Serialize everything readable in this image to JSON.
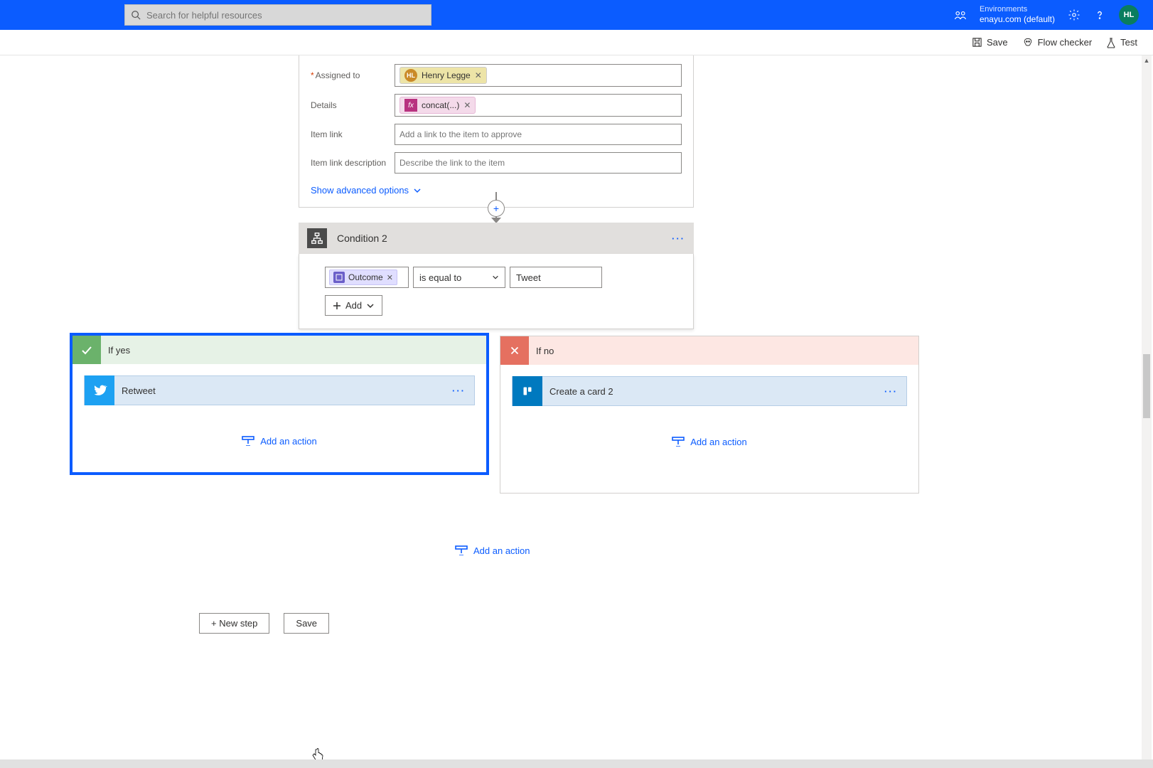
{
  "header": {
    "search_placeholder": "Search for helpful resources",
    "env_label": "Environments",
    "env_name": "enayu.com (default)",
    "avatar_initials": "HL"
  },
  "actionbar": {
    "save": "Save",
    "flow_checker": "Flow checker",
    "test": "Test"
  },
  "approval": {
    "assigned_label": "Assigned to",
    "assignee_name": "Henry Legge",
    "assignee_initials": "HL",
    "details_label": "Details",
    "details_fx": "concat(...)",
    "item_link_label": "Item link",
    "item_link_placeholder": "Add a link to the item to approve",
    "item_link_desc_label": "Item link description",
    "item_link_desc_placeholder": "Describe the link to the item",
    "show_advanced": "Show advanced options"
  },
  "condition": {
    "title": "Condition 2",
    "outcome_token": "Outcome",
    "operator": "is equal to",
    "value": "Tweet",
    "add_label": "Add"
  },
  "branches": {
    "yes_label": "If yes",
    "no_label": "If no",
    "yes_action_name": "Retweet",
    "no_action_name": "Create a card 2",
    "add_action": "Add an action"
  },
  "footer": {
    "add_action": "Add an action",
    "new_step": "+ New step",
    "save": "Save"
  }
}
